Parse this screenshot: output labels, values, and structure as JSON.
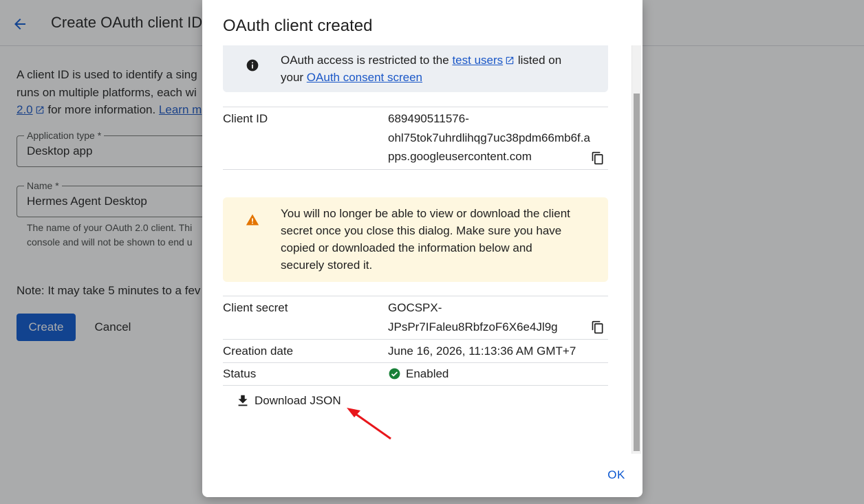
{
  "background": {
    "header": {
      "title": "Create OAuth client ID"
    },
    "description": {
      "line1": "A client ID is used to identify a sing",
      "line2": "runs on multiple platforms, each wi",
      "link_oauth": "2.0",
      "line3_text": " for more information. ",
      "link_learn": "Learn m"
    },
    "application_type": {
      "label": "Application type *",
      "value": "Desktop app"
    },
    "name": {
      "label": "Name *",
      "value": "Hermes Agent Desktop",
      "helper_line1": "The name of your OAuth 2.0 client. Thi",
      "helper_line2": "console and will not be shown to end u"
    },
    "note": "Note: It may take 5 minutes to a fev",
    "create_label": "Create",
    "cancel_label": "Cancel"
  },
  "dialog": {
    "title": "OAuth client created",
    "info": {
      "text1": "OAuth access is restricted to the ",
      "link_test_users": "test users",
      "text2": " listed on",
      "text3": "your ",
      "link_consent": "OAuth consent screen"
    },
    "client_id": {
      "label": "Client ID",
      "value_line1": "689490511576-",
      "value_line2": "ohl75tok7uhrdlihqg7uc38pdm66mb6f.a",
      "value_line3": "pps.googleusercontent.com"
    },
    "warning": {
      "line1": "You will no longer be able to view or download the client",
      "line2": "secret once you close this dialog. Make sure you have",
      "line3": "copied or downloaded the information below and",
      "line4": "securely stored it."
    },
    "client_secret": {
      "label": "Client secret",
      "value_line1": "GOCSPX-",
      "value_line2": "JPsPr7IFaleu8RbfzoF6X6e4Jl9g"
    },
    "creation_date": {
      "label": "Creation date",
      "value": "June 16, 2026, 11:13:36 AM GMT+7"
    },
    "status": {
      "label": "Status",
      "value": "Enabled"
    },
    "download_label": "Download JSON",
    "ok_label": "OK"
  },
  "icons": {
    "back": "arrow-back-icon",
    "info": "info-icon",
    "warning": "warning-icon",
    "copy": "copy-icon",
    "check": "check-circle-icon",
    "download": "download-icon",
    "external": "external-link-icon"
  },
  "colors": {
    "primary": "#0b57d0",
    "link": "#1a57c7",
    "info_bg": "#eceff3",
    "warning_bg": "#fef7e0",
    "warning_icon": "#e37400",
    "success": "#188038",
    "annotation_arrow": "#e8161b"
  }
}
